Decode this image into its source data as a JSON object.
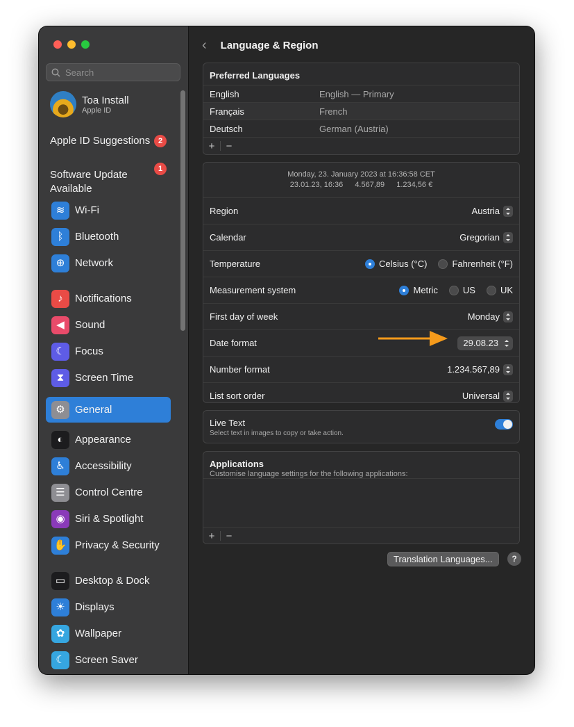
{
  "search": {
    "placeholder": "Search"
  },
  "account": {
    "name": "Toa Install",
    "sub": "Apple ID"
  },
  "suggestions": [
    {
      "label": "Apple ID Suggestions",
      "badge": "2"
    },
    {
      "label": "Software Update\nAvailable",
      "badge": "1"
    }
  ],
  "sidebar": {
    "items": [
      {
        "label": "Wi-Fi",
        "icon": "wifi-icon",
        "color": "#2e7fd8",
        "glyph": "≋"
      },
      {
        "label": "Bluetooth",
        "icon": "bluetooth-icon",
        "color": "#2e7fd8",
        "glyph": "ᛒ"
      },
      {
        "label": "Network",
        "icon": "globe-icon",
        "color": "#2e7fd8",
        "glyph": "⊕"
      },
      {
        "label": "Notifications",
        "icon": "bell-icon",
        "color": "#e94b46",
        "glyph": "♪"
      },
      {
        "label": "Sound",
        "icon": "speaker-icon",
        "color": "#e94b6a",
        "glyph": "◀"
      },
      {
        "label": "Focus",
        "icon": "moon-icon",
        "color": "#5e5ce6",
        "glyph": "☾"
      },
      {
        "label": "Screen Time",
        "icon": "hourglass-icon",
        "color": "#5e5ce6",
        "glyph": "⧗"
      },
      {
        "label": "General",
        "icon": "gear-icon",
        "color": "#8e8e93",
        "glyph": "⚙"
      },
      {
        "label": "Appearance",
        "icon": "appearance-icon",
        "color": "#1c1c1e",
        "glyph": "◐"
      },
      {
        "label": "Accessibility",
        "icon": "accessibility-icon",
        "color": "#2e7fd8",
        "glyph": "♿"
      },
      {
        "label": "Control Centre",
        "icon": "toggles-icon",
        "color": "#8e8e93",
        "glyph": "☰"
      },
      {
        "label": "Siri & Spotlight",
        "icon": "siri-icon",
        "color": "#8a3ab9",
        "glyph": "◉"
      },
      {
        "label": "Privacy & Security",
        "icon": "hand-icon",
        "color": "#2e7fd8",
        "glyph": "✋"
      },
      {
        "label": "Desktop & Dock",
        "icon": "dock-icon",
        "color": "#1c1c1e",
        "glyph": "▭"
      },
      {
        "label": "Displays",
        "icon": "sun-icon",
        "color": "#2e7fd8",
        "glyph": "☀"
      },
      {
        "label": "Wallpaper",
        "icon": "flower-icon",
        "color": "#36a6e0",
        "glyph": "✿"
      },
      {
        "label": "Screen Saver",
        "icon": "screensaver-icon",
        "color": "#36a6e0",
        "glyph": "☾"
      }
    ]
  },
  "header": {
    "title": "Language & Region"
  },
  "preferred": {
    "title": "Preferred Languages",
    "rows": [
      {
        "name": "English",
        "desc": "English — Primary"
      },
      {
        "name": "Français",
        "desc": "French"
      },
      {
        "name": "Deutsch",
        "desc": "German (Austria)"
      }
    ]
  },
  "controls": {
    "add": "+",
    "remove": "−"
  },
  "preview": {
    "line1": "Monday, 23. January 2023 at 16:36:58 CET",
    "short_date": "23.01.23, 16:36",
    "number": "4.567,89",
    "currency": "1.234,56 €"
  },
  "settings": {
    "region": {
      "label": "Region",
      "value": "Austria"
    },
    "calendar": {
      "label": "Calendar",
      "value": "Gregorian"
    },
    "temperature": {
      "label": "Temperature",
      "options": [
        "Celsius (°C)",
        "Fahrenheit (°F)"
      ],
      "selected": "Celsius (°C)"
    },
    "measurement": {
      "label": "Measurement system",
      "options": [
        "Metric",
        "US",
        "UK"
      ],
      "selected": "Metric"
    },
    "first_day": {
      "label": "First day of week",
      "value": "Monday"
    },
    "date_format": {
      "label": "Date format",
      "value": "29.08.23"
    },
    "number_format": {
      "label": "Number format",
      "value": "1.234.567,89"
    },
    "sort_order": {
      "label": "List sort order",
      "value": "Universal"
    }
  },
  "live_text": {
    "title": "Live Text",
    "desc": "Select text in images to copy or take action.",
    "enabled": true
  },
  "applications": {
    "title": "Applications",
    "desc": "Customise language settings for the following applications:"
  },
  "translation_button": "Translation Languages...",
  "help": "?",
  "colors": {
    "accent": "#2e7fd8",
    "arrow": "#f59a1b",
    "badge": "#e94b46"
  }
}
